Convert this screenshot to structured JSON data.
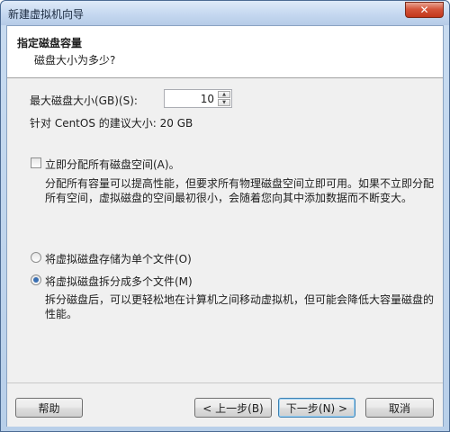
{
  "window": {
    "title": "新建虚拟机向导",
    "close_icon": "close-icon"
  },
  "header": {
    "title": "指定磁盘容量",
    "subtitle": "磁盘大小为多少?"
  },
  "disk": {
    "size_label": "最大磁盘大小(GB)(S):",
    "size_value": "10",
    "recommend": "针对 CentOS 的建议大小: 20 GB"
  },
  "allocate": {
    "label": "立即分配所有磁盘空间(A)。",
    "checked": false,
    "desc_line1": "分配所有容量可以提高性能，但要求所有物理磁盘空间立即可用。如果不立即分配",
    "desc_line2": "所有空间，虚拟磁盘的空间最初很小，会随着您向其中添加数据而不断变大。"
  },
  "storage": {
    "single_label": "将虚拟磁盘存储为单个文件(O)",
    "multi_label": "将虚拟磁盘拆分成多个文件(M)",
    "selected": "multi",
    "multi_desc_line1": "拆分磁盘后，可以更轻松地在计算机之间移动虚拟机，但可能会降低大容量磁盘的",
    "multi_desc_line2": "性能。"
  },
  "buttons": {
    "help": "帮助",
    "back": "< 上一步(B)",
    "next": "下一步(N) >",
    "cancel": "取消"
  },
  "colors": {
    "title_bar": "#c5d8f0",
    "close": "#c2361b",
    "radio_dot": "#3a6fb2"
  }
}
